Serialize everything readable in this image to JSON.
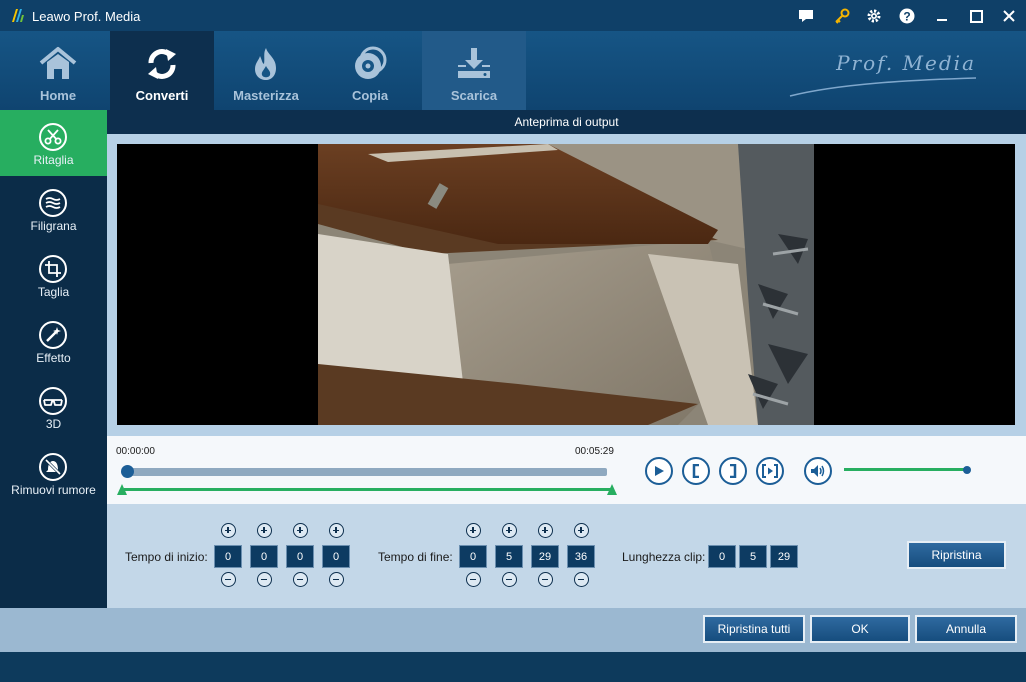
{
  "window": {
    "title": "Leawo Prof. Media",
    "brand": "Prof. Media"
  },
  "nav": {
    "tabs": [
      {
        "label": "Home"
      },
      {
        "label": "Converti"
      },
      {
        "label": "Masterizza"
      },
      {
        "label": "Copia"
      },
      {
        "label": "Scarica"
      }
    ]
  },
  "sidebar": {
    "items": [
      {
        "label": "Ritaglia"
      },
      {
        "label": "Filigrana"
      },
      {
        "label": "Taglia"
      },
      {
        "label": "Effetto"
      },
      {
        "label": "3D"
      },
      {
        "label": "Rimuovi rumore"
      }
    ]
  },
  "preview": {
    "header": "Anteprima di output"
  },
  "player": {
    "current_time": "00:00:00",
    "total_time": "00:05:29",
    "progress": 0,
    "volume": 1.0
  },
  "trim": {
    "start_label": "Tempo di inizio:",
    "start_values": [
      "0",
      "0",
      "0",
      "0"
    ],
    "end_label": "Tempo di fine:",
    "end_values": [
      "0",
      "5",
      "29",
      "36"
    ],
    "length_label": "Lunghezza clip:",
    "length_values": [
      "0",
      "5",
      "29"
    ],
    "reset_label": "Ripristina"
  },
  "footer": {
    "reset_all_label": "Ripristina tutti",
    "ok_label": "OK",
    "cancel_label": "Annulla"
  },
  "colors": {
    "accent_green": "#27ae60",
    "primary_blue": "#1c5e97",
    "dark_navy": "#0d2f4e"
  }
}
